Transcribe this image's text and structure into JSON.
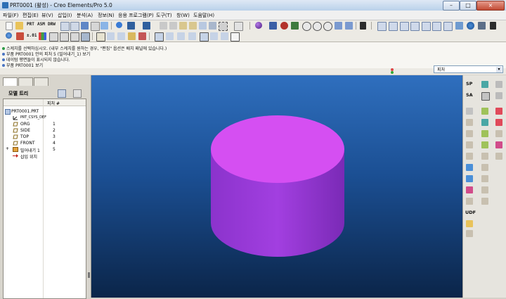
{
  "window": {
    "title": "PRT0001 (활성) - Creo Elements/Pro 5.0",
    "minimize": "–",
    "maximize": "□",
    "close": "×"
  },
  "menu": {
    "items": [
      "파일(F)",
      "편집(E)",
      "뷰(V)",
      "삽입(I)",
      "분석(A)",
      "정보(N)",
      "응용 프로그램(P)",
      "도구(T)",
      "창(W)",
      "도움말(H)"
    ]
  },
  "toolbar": {
    "text_buttons": [
      "PRT",
      "ASM",
      "DRW"
    ],
    "precision": "±.01",
    "analysis": "SP",
    "analysis2": "SA"
  },
  "messages": [
    "스케치를 선택하십시오. (내부 스케치를 원하는 경우, \"편집\" 옵션은 배치 패널에 있습니다.)",
    "부품 PRT0001 안의 피처 5 (밀어내기_1) 보기",
    "데이텀 평면들이 표시되지 않습니다.",
    "부품 PRT0001 보기"
  ],
  "filter": {
    "value": "피처"
  },
  "model_tree": {
    "title": "모델 트리",
    "column_header": "피처 #",
    "items": [
      {
        "name": "PRT0001.PRT",
        "number": ""
      },
      {
        "name": "PRT_CSYS_DEF",
        "number": ""
      },
      {
        "name": "ORG",
        "number": "1"
      },
      {
        "name": "SIDE",
        "number": "2"
      },
      {
        "name": "TOP",
        "number": "3"
      },
      {
        "name": "FRONT",
        "number": "4"
      },
      {
        "name": "밀어내기 1",
        "number": "5"
      },
      {
        "name": "삽입 위치",
        "number": ""
      }
    ]
  },
  "right_toolbar": {
    "udf_label": "UDF"
  },
  "colors": {
    "cylinder_top": "#d54ff2",
    "cylinder_side": "#9b3fd8",
    "viewport_top": "#2f6fbe",
    "viewport_bottom": "#0b2549"
  }
}
